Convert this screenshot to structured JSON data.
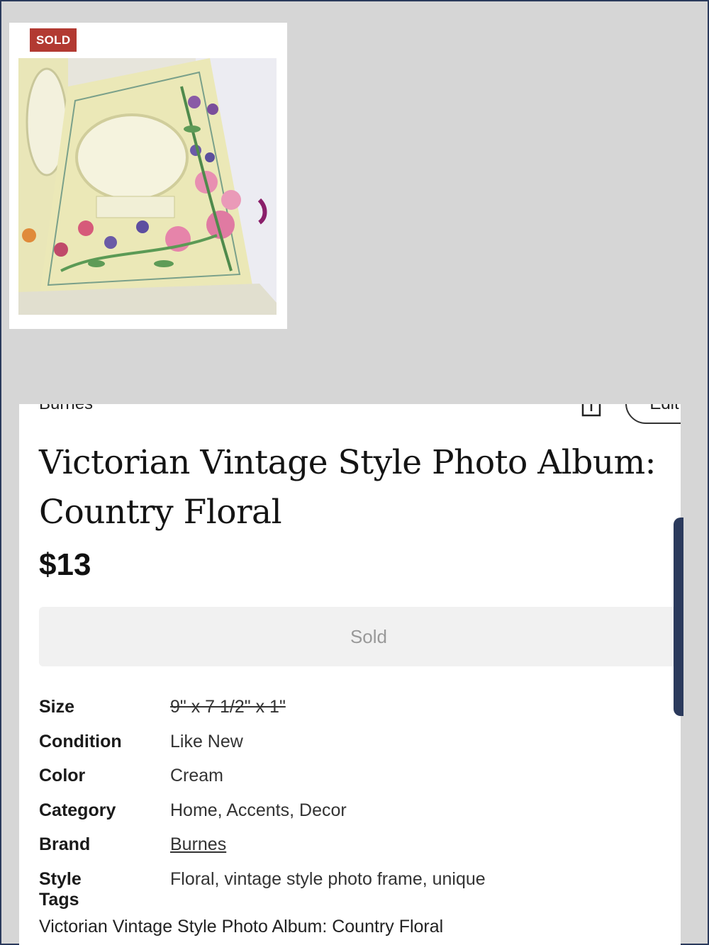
{
  "thumbnail": {
    "badge": "SOLD",
    "alt": "Floral photo album"
  },
  "header": {
    "brand_partial": "Burnes",
    "edit_label": "Edit"
  },
  "listing": {
    "title": "Victorian Vintage Style Photo Album: Country Floral",
    "price": "$13",
    "status_button": "Sold"
  },
  "specs": {
    "size": {
      "label": "Size",
      "value": "9\" x 7 1/2\" x 1\""
    },
    "condition": {
      "label": "Condition",
      "value": "Like New"
    },
    "color": {
      "label": "Color",
      "value": "Cream"
    },
    "category": {
      "label": "Category",
      "value": "Home, Accents, Decor"
    },
    "brand": {
      "label": "Brand",
      "value": "Burnes"
    },
    "style_tags": {
      "label": "Style Tags",
      "value": "Floral, vintage style photo frame, unique"
    }
  },
  "description": "Victorian Vintage Style Photo Album: Country Floral",
  "colors": {
    "sold_badge": "#b23a32",
    "frame": "#2b3a5c",
    "background": "#d6d6d6"
  }
}
